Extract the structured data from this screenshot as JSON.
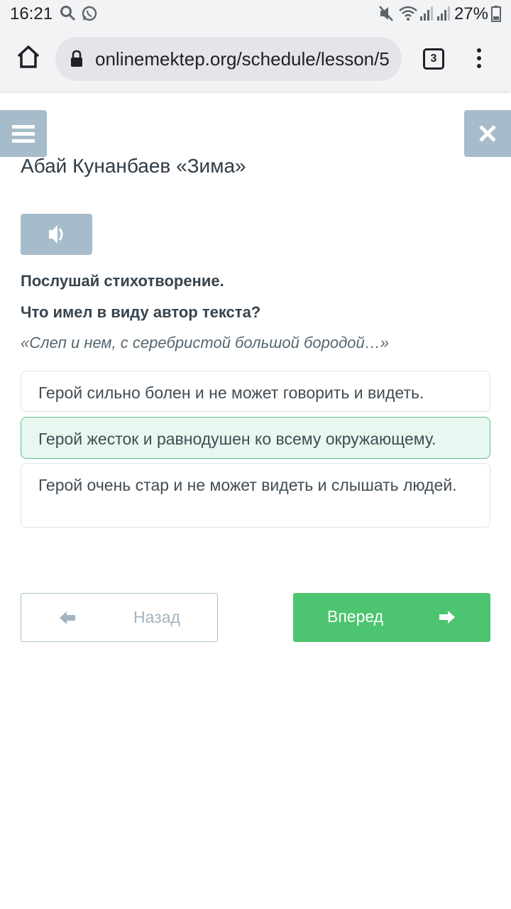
{
  "status_bar": {
    "time": "16:21",
    "battery": "27%",
    "icons": [
      "search-icon",
      "whatsapp-icon",
      "mute-icon",
      "wifi-icon",
      "signal-icon",
      "signal-icon",
      "battery-icon"
    ]
  },
  "browser": {
    "url": "onlinemektep.org/schedule/lesson/5",
    "tab_count": "3"
  },
  "lesson": {
    "title": "Абай Кунанбаев «Зима»",
    "instruction": "Послушай стихотворение.",
    "question": "Что имел в виду автор текста?",
    "quote": "«Слеп и нем, с серебристой большой бородой…»",
    "options": [
      {
        "text": "Герой сильно болен и не может говорить и видеть.",
        "selected": false
      },
      {
        "text": "Герой жесток и равнодушен ко всему окружающему.",
        "selected": true
      },
      {
        "text": "Герой очень стар и не может видеть и слышать людей.",
        "selected": false
      }
    ]
  },
  "navigation": {
    "back_label": "Назад",
    "next_label": "Вперед"
  },
  "colors": {
    "accent_gray": "#a6bccb",
    "next_green": "#4dc46f",
    "selected_bg": "#e8f7f0",
    "selected_border": "#5fc08a"
  }
}
